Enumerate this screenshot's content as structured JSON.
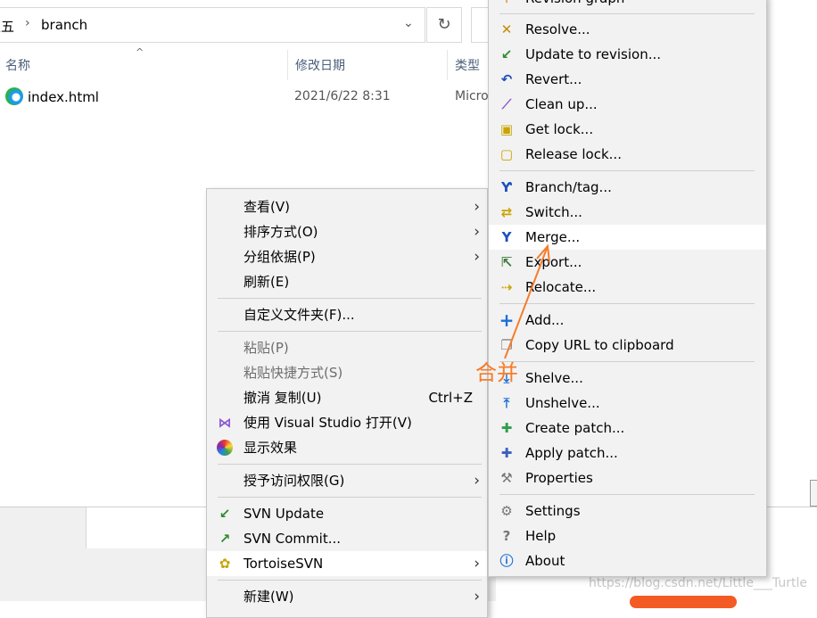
{
  "explorer": {
    "address_prefix": "王五",
    "address_folder": "branch",
    "col_name": "名称",
    "col_date": "修改日期",
    "col_type": "类型",
    "file": {
      "name": "index.html",
      "date": "2021/6/22 8:31",
      "type": "Micro"
    }
  },
  "menu1": {
    "items": [
      {
        "label": "查看(V)",
        "submenu": true
      },
      {
        "label": "排序方式(O)",
        "submenu": true
      },
      {
        "label": "分组依据(P)",
        "submenu": true
      },
      {
        "label": "刷新(E)"
      },
      {
        "label": "自定义文件夹(F)..."
      },
      {
        "label": "粘贴(P)",
        "disabled": true
      },
      {
        "label": "粘贴快捷方式(S)",
        "disabled": true
      },
      {
        "label": "撤消 复制(U)",
        "shortcut": "Ctrl+Z"
      },
      {
        "label": "使用 Visual Studio 打开(V)"
      },
      {
        "label": "显示效果"
      },
      {
        "label": "授予访问权限(G)",
        "submenu": true
      },
      {
        "label": "SVN Update"
      },
      {
        "label": "SVN Commit..."
      },
      {
        "label": "TortoiseSVN",
        "submenu": true
      },
      {
        "label": "新建(W)",
        "submenu": true
      }
    ]
  },
  "menu2": {
    "items": [
      {
        "label": "Revision graph"
      },
      {
        "label": "Resolve..."
      },
      {
        "label": "Update to revision..."
      },
      {
        "label": "Revert..."
      },
      {
        "label": "Clean up..."
      },
      {
        "label": "Get lock..."
      },
      {
        "label": "Release lock..."
      },
      {
        "label": "Branch/tag..."
      },
      {
        "label": "Switch..."
      },
      {
        "label": "Merge..."
      },
      {
        "label": "Export..."
      },
      {
        "label": "Relocate..."
      },
      {
        "label": "Add..."
      },
      {
        "label": "Copy URL to clipboard"
      },
      {
        "label": "Shelve..."
      },
      {
        "label": "Unshelve..."
      },
      {
        "label": "Create patch..."
      },
      {
        "label": "Apply patch..."
      },
      {
        "label": "Properties"
      },
      {
        "label": "Settings"
      },
      {
        "label": "Help"
      },
      {
        "label": "About"
      }
    ]
  },
  "annotation": "合并",
  "watermark": "https://blog.csdn.net/Little___Turtle",
  "colors": {
    "accent_annotation": "#f57c2a",
    "menu_bg": "#f2f2f2",
    "highlight": "#ffffff"
  }
}
